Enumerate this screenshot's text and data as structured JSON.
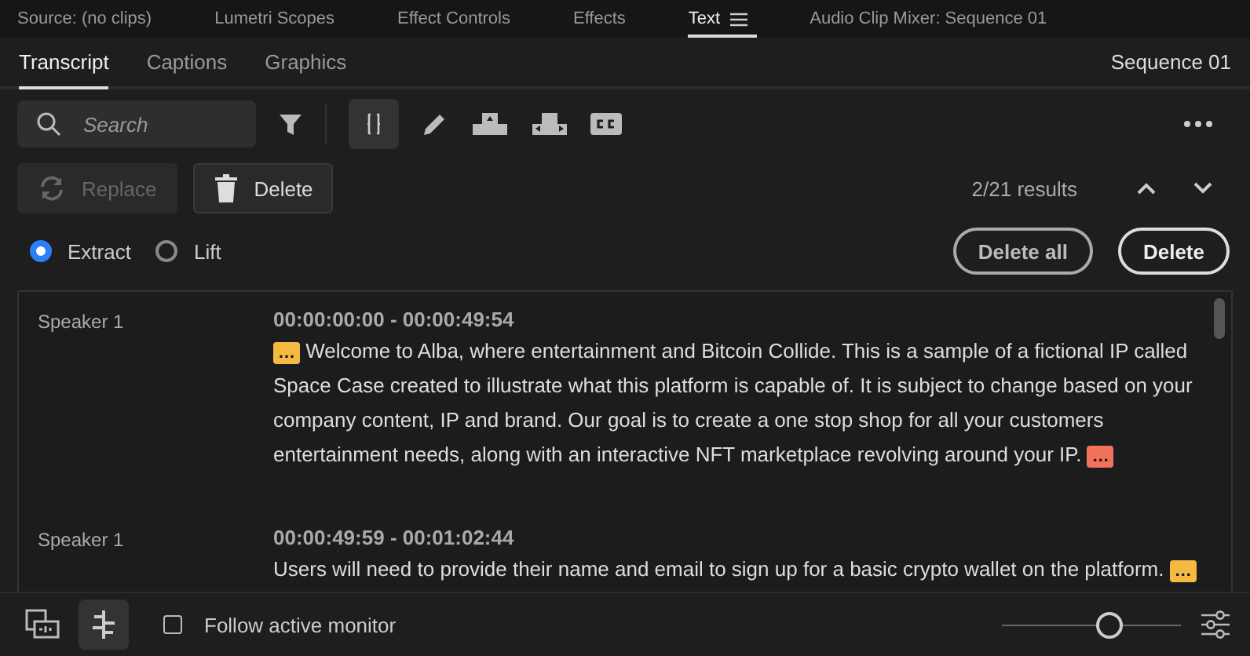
{
  "panel_tabs": [
    {
      "label": "Source: (no clips)",
      "selected": false
    },
    {
      "label": "Lumetri Scopes",
      "selected": false
    },
    {
      "label": "Effect Controls",
      "selected": false
    },
    {
      "label": "Effects",
      "selected": false
    },
    {
      "label": "Text",
      "selected": true
    },
    {
      "label": "Audio Clip Mixer: Sequence 01",
      "selected": false
    }
  ],
  "sub_tabs": [
    {
      "label": "Transcript",
      "selected": true
    },
    {
      "label": "Captions",
      "selected": false
    },
    {
      "label": "Graphics",
      "selected": false
    }
  ],
  "sequence_name": "Sequence 01",
  "search": {
    "placeholder": "Search"
  },
  "toolbar": {
    "replace": {
      "label": "Replace",
      "disabled": true
    },
    "delete": {
      "label": "Delete",
      "disabled": false
    },
    "results": "2/21 results"
  },
  "mode": [
    {
      "label": "Extract",
      "selected": true
    },
    {
      "label": "Lift",
      "selected": false
    }
  ],
  "actions": [
    {
      "label": "Delete all",
      "kind": "secondary"
    },
    {
      "label": "Delete",
      "kind": "primary"
    }
  ],
  "segments": [
    {
      "speaker": "Speaker 1",
      "time": "00:00:00:00 - 00:00:49:54",
      "parts": [
        {
          "kind": "marker",
          "label": "…",
          "color": "#f5b942"
        },
        {
          "kind": "text",
          "text": "Welcome to Alba, where entertainment and Bitcoin Collide. This is a sample of a fictional IP called Space Case created to illustrate what this platform is capable of. It is subject to change based on your company content, IP and brand. Our goal is to create a one stop shop for all your customers entertainment needs, along with an interactive NFT marketplace revolving around your IP."
        },
        {
          "kind": "marker",
          "label": "…",
          "color": "#f0735a"
        }
      ]
    },
    {
      "speaker": "Speaker 1",
      "time": "00:00:49:59 - 00:01:02:44",
      "parts": [
        {
          "kind": "text",
          "text": "Users will need to provide their name and email to sign up for a basic crypto wallet on the platform."
        },
        {
          "kind": "marker",
          "label": "…",
          "color": "#f5b942"
        }
      ]
    }
  ],
  "footer": {
    "follow_monitor": {
      "label": "Follow active monitor",
      "checked": false
    },
    "zoom": {
      "level": 0.6
    }
  }
}
